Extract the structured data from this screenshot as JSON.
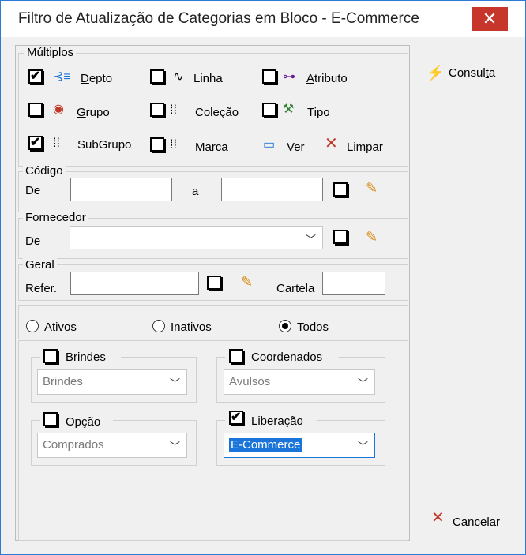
{
  "window": {
    "title": "Filtro de Atualização de Categorias em Bloco - E-Commerce",
    "close_glyph": "✕"
  },
  "multiplos": {
    "title": "Múltiplos",
    "depto": "Depto",
    "grupo": "Grupo",
    "subgrupo": "SubGrupo",
    "linha": "Linha",
    "colecao": "Coleção",
    "marca": "Marca",
    "atributo": "Atributo",
    "tipo": "Tipo",
    "ver": "Ver",
    "limpar": "Limpar",
    "checked": {
      "depto": true,
      "subgrupo": true
    }
  },
  "codigo": {
    "title": "Código",
    "de": "De",
    "a": "a",
    "from_value": "",
    "to_value": ""
  },
  "fornecedor": {
    "title": "Fornecedor",
    "de": "De",
    "value": ""
  },
  "geral": {
    "title": "Geral",
    "refer": "Refer.",
    "cartela": "Cartela",
    "refer_value": "",
    "cartela_value": ""
  },
  "status": {
    "ativos": "Ativos",
    "inativos": "Inativos",
    "todos": "Todos",
    "selected": "Todos"
  },
  "brindes": {
    "title": "Brindes",
    "value": "Brindes"
  },
  "coordenados": {
    "title": "Coordenados",
    "value": "Avulsos"
  },
  "opcao": {
    "title": "Opção",
    "value": "Comprados"
  },
  "liberacao": {
    "title": "Liberação",
    "value": "E-Commerce",
    "checked": true
  },
  "buttons": {
    "consulta": "Consulta",
    "cancelar": "Cancelar"
  },
  "colors": {
    "accent": "#1a74d9",
    "close": "#c7362b"
  }
}
